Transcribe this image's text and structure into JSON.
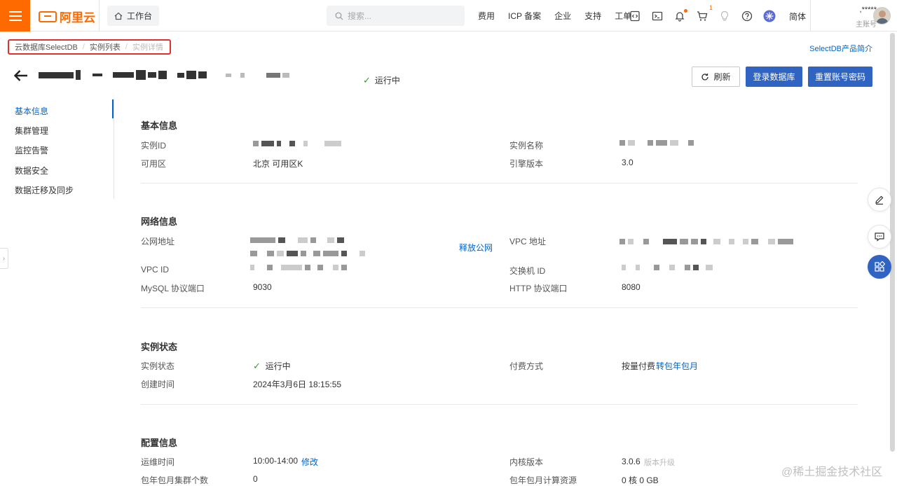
{
  "topbar": {
    "logo_text": "阿里云",
    "workbench": "工作台",
    "search_placeholder": "搜索...",
    "nav": [
      "费用",
      "ICP 备案",
      "企业",
      "支持",
      "工单"
    ],
    "cart_badge": "1",
    "lang": "简体",
    "account_name": ",*****",
    "account_role": "主账号"
  },
  "breadcrumb": {
    "items": [
      "云数据库SelectDB",
      "实例列表"
    ],
    "current": "实例详情"
  },
  "product_intro": "SelectDB产品简介",
  "title": {
    "status": "运行中"
  },
  "buttons": {
    "refresh": "刷新",
    "login_db": "登录数据库",
    "reset_password": "重置账号密码"
  },
  "leftnav": [
    "基本信息",
    "集群管理",
    "监控告警",
    "数据安全",
    "数据迁移及同步"
  ],
  "basic": {
    "title": "基本信息",
    "instance_id_label": "实例ID",
    "instance_name_label": "实例名称",
    "zone_label": "可用区",
    "zone_value": "北京 可用区K",
    "engine_label": "引擎版本",
    "engine_value": "3.0"
  },
  "network": {
    "title": "网络信息",
    "public_label": "公网地址",
    "release_public": "释放公网",
    "vpc_addr_label": "VPC 地址",
    "vpc_id_label": "VPC ID",
    "vswitch_label": "交换机 ID",
    "mysql_port_label": "MySQL 协议端口",
    "mysql_port_value": "9030",
    "http_port_label": "HTTP 协议端口",
    "http_port_value": "8080"
  },
  "status": {
    "title": "实例状态",
    "state_label": "实例状态",
    "state_value": "运行中",
    "pay_label": "付费方式",
    "pay_value": "按量付费",
    "pay_switch": "转包年包月",
    "created_label": "创建时间",
    "created_value": "2024年3月6日 18:15:55"
  },
  "config": {
    "title": "配置信息",
    "maint_label": "运维时间",
    "maint_value": "10:00-14:00",
    "maint_edit": "修改",
    "kernel_label": "内核版本",
    "kernel_value": "3.0.6",
    "kernel_upgrade": "版本升级",
    "monthly_clusters_label": "包年包月集群个数",
    "monthly_clusters_value": "0",
    "monthly_compute_label": "包年包月计算资源",
    "monthly_compute_value": "0 核 0 GB"
  },
  "watermark": "@稀土掘金技术社区",
  "colors": {
    "brand_orange": "#ff6a00",
    "primary_blue": "#2f64c2",
    "link_blue": "#0064c8",
    "success_green": "#2ea121",
    "highlight_red": "#e0312b"
  }
}
